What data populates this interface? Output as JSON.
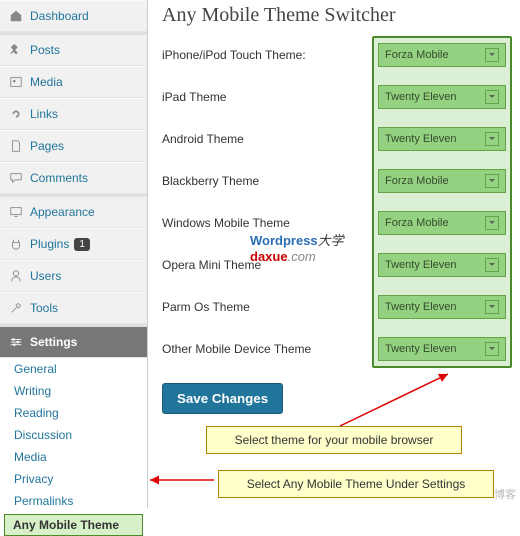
{
  "sidebar": {
    "dashboard": "Dashboard",
    "posts": "Posts",
    "media": "Media",
    "links": "Links",
    "pages": "Pages",
    "comments": "Comments",
    "appearance": "Appearance",
    "plugins": "Plugins",
    "plugins_badge": "1",
    "users": "Users",
    "tools": "Tools",
    "settings": "Settings",
    "sub": {
      "general": "General",
      "writing": "Writing",
      "reading": "Reading",
      "discussion": "Discussion",
      "media": "Media",
      "privacy": "Privacy",
      "permalinks": "Permalinks",
      "any_mobile": "Any Mobile Theme"
    }
  },
  "page": {
    "title": "Any Mobile Theme Switcher",
    "rows": [
      {
        "label": "iPhone/iPod Touch Theme:",
        "value": "Forza Mobile"
      },
      {
        "label": "iPad Theme",
        "value": "Twenty Eleven"
      },
      {
        "label": "Android Theme",
        "value": "Twenty Eleven"
      },
      {
        "label": "Blackberry Theme",
        "value": "Forza Mobile"
      },
      {
        "label": "Windows Mobile Theme",
        "value": "Forza Mobile"
      },
      {
        "label": "Opera Mini Theme",
        "value": "Twenty Eleven"
      },
      {
        "label": "Parm Os Theme",
        "value": "Twenty Eleven"
      },
      {
        "label": "Other Mobile Device Theme",
        "value": "Twenty Eleven"
      }
    ],
    "save": "Save Changes"
  },
  "callouts": {
    "c1": "Select theme for your mobile browser",
    "c2": "Select Any Mobile Theme Under Settings"
  },
  "watermark": {
    "w": "Wordpress",
    "d": "daxue",
    "c": ".com",
    "sub": "大学"
  },
  "footer_tag": "博客"
}
